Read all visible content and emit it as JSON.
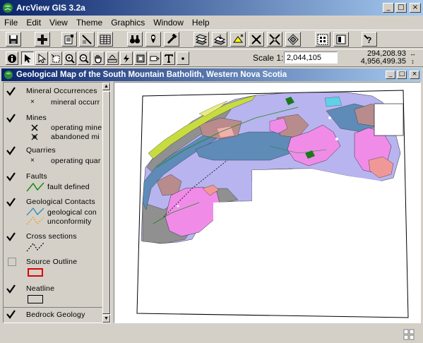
{
  "window": {
    "title": "ArcView GIS 3.2a",
    "controls": {
      "minimize": "_",
      "maximize": "□",
      "close": "×"
    }
  },
  "menu": [
    "File",
    "Edit",
    "View",
    "Theme",
    "Graphics",
    "Window",
    "Help"
  ],
  "toolbar": {
    "scale_label": "Scale 1:",
    "scale_value": "2,044,105",
    "coord_x": "294,208.93",
    "coord_y": "4,956,499.35"
  },
  "view": {
    "title": "Geological Map of the South Mountain Batholith, Western Nova Scotia"
  },
  "toc": {
    "themes": [
      {
        "name": "Mineral Occurrences",
        "visible": true,
        "legend": [
          {
            "symbol": "x-mark",
            "label": "mineral occurr"
          }
        ]
      },
      {
        "name": "Mines",
        "visible": true,
        "legend": [
          {
            "symbol": "mine-icon",
            "label": "operating mine"
          },
          {
            "symbol": "abandoned-mine-icon",
            "label": "abandoned mi"
          }
        ]
      },
      {
        "name": "Quarries",
        "visible": true,
        "legend": [
          {
            "symbol": "x-mark",
            "label": "operating quar"
          }
        ]
      },
      {
        "name": "Faults",
        "visible": true,
        "legend": [
          {
            "symbol": "green-line",
            "label": "fault defined"
          }
        ]
      },
      {
        "name": "Geological Contacts",
        "visible": true,
        "legend": [
          {
            "symbol": "teal-line",
            "label": "geological con"
          },
          {
            "symbol": "orange-dashed-line",
            "label": "unconformity"
          }
        ]
      },
      {
        "name": "Cross sections",
        "visible": true,
        "legend": [
          {
            "symbol": "black-dashed-line",
            "label": ""
          }
        ]
      },
      {
        "name": "Source Outline",
        "visible": false,
        "legend": [
          {
            "symbol": "red-box",
            "label": ""
          }
        ]
      },
      {
        "name": "Neatline",
        "visible": true,
        "legend": [
          {
            "symbol": "gray-box",
            "label": ""
          }
        ]
      },
      {
        "name": "Bedrock Geology",
        "visible": true,
        "legend": []
      }
    ]
  },
  "colors": {
    "title_active": "#0a246a",
    "title_gradient": "#a6caf0",
    "granite_pink": "#f08ce8",
    "lavender": "#b8b4f0",
    "steel_blue": "#5e8bb8",
    "gray_slate": "#909090",
    "rose_brown": "#b88c8c",
    "yellow_green": "#c8dc40",
    "salmon": "#f09898"
  }
}
